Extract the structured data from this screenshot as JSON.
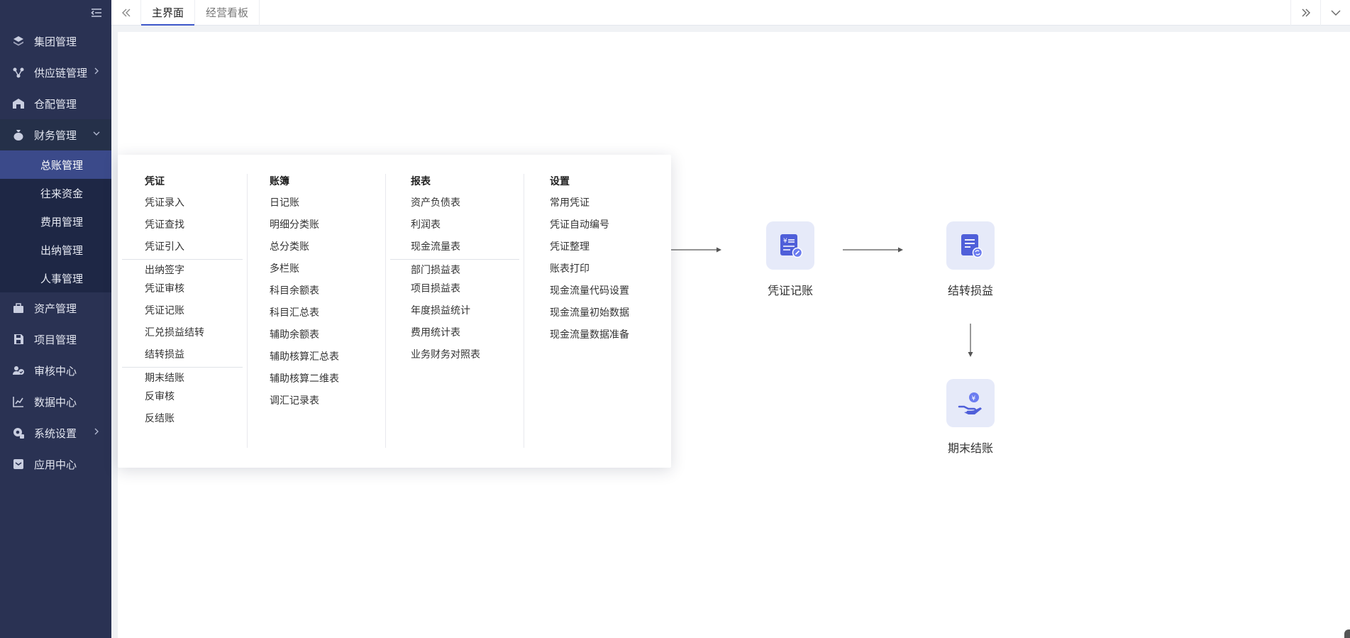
{
  "sidebar": {
    "items": [
      {
        "label": "集团管理",
        "icon": "layers-icon"
      },
      {
        "label": "供应链管理",
        "icon": "network-icon"
      },
      {
        "label": "仓配管理",
        "icon": "warehouse-icon"
      },
      {
        "label": "财务管理",
        "icon": "money-bag-icon"
      },
      {
        "label": "资产管理",
        "icon": "asset-icon"
      },
      {
        "label": "项目管理",
        "icon": "save-icon"
      },
      {
        "label": "审核中心",
        "icon": "audit-icon"
      },
      {
        "label": "数据中心",
        "icon": "chart-icon"
      },
      {
        "label": "系统设置",
        "icon": "settings-icon"
      },
      {
        "label": "应用中心",
        "icon": "app-icon"
      }
    ],
    "finance_sub": [
      "总账管理",
      "往来资金",
      "费用管理",
      "出纳管理",
      "人事管理"
    ]
  },
  "tabs": [
    "主界面",
    "经营看板"
  ],
  "menu": {
    "col0": {
      "title": "凭证",
      "links": [
        "凭证录入",
        "凭证查找",
        "凭证引入",
        "出纳签字",
        "凭证审核",
        "凭证记账",
        "汇兑损益结转",
        "结转损益",
        "期末结账",
        "反审核",
        "反结账"
      ]
    },
    "col1": {
      "title": "账簿",
      "links": [
        "日记账",
        "明细分类账",
        "总分类账",
        "多栏账",
        "科目余额表",
        "科目汇总表",
        "辅助余额表",
        "辅助核算汇总表",
        "辅助核算二维表",
        "调汇记录表"
      ]
    },
    "col2": {
      "title": "报表",
      "links": [
        "资产负债表",
        "利润表",
        "现金流量表",
        "部门损益表",
        "项目损益表",
        "年度损益统计",
        "费用统计表",
        "业务财务对照表"
      ]
    },
    "col3": {
      "title": "设置",
      "links": [
        "常用凭证",
        "凭证自动编号",
        "凭证整理",
        "账表打印",
        "现金流量代码设置",
        "现金流量初始数据",
        "现金流量数据准备"
      ]
    }
  },
  "flow": {
    "nodes": [
      "凭证记账",
      "结转损益",
      "期末结账"
    ]
  },
  "colors": {
    "sidebar_bg": "#2a3253",
    "active_sub": "#3b4a8a",
    "accent": "#3e57c9",
    "icon_tile": "#e6eaf9"
  }
}
